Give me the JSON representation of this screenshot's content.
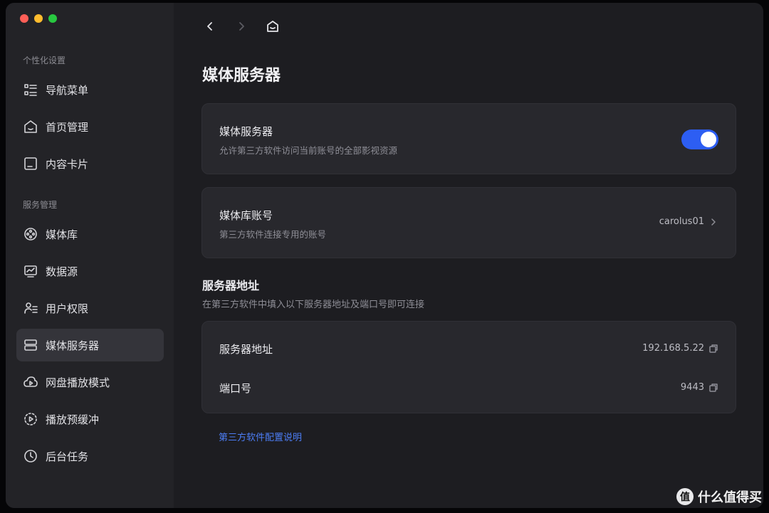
{
  "sidebar": {
    "section_personal": "个性化设置",
    "section_service": "服务管理",
    "items": [
      {
        "label": "导航菜单",
        "icon": "list-icon"
      },
      {
        "label": "首页管理",
        "icon": "home-icon"
      },
      {
        "label": "内容卡片",
        "icon": "card-icon"
      },
      {
        "label": "媒体库",
        "icon": "film-reel-icon"
      },
      {
        "label": "数据源",
        "icon": "monitor-chart-icon"
      },
      {
        "label": "用户权限",
        "icon": "user-list-icon"
      },
      {
        "label": "媒体服务器",
        "icon": "server-icon",
        "active": true
      },
      {
        "label": "网盘播放模式",
        "icon": "cloud-play-icon"
      },
      {
        "label": "播放预缓冲",
        "icon": "buffer-play-icon"
      },
      {
        "label": "后台任务",
        "icon": "clock-icon"
      }
    ]
  },
  "page": {
    "title": "媒体服务器"
  },
  "server_card": {
    "title": "媒体服务器",
    "desc": "允许第三方软件访问当前账号的全部影视资源",
    "enabled": true
  },
  "account_card": {
    "title": "媒体库账号",
    "desc": "第三方软件连接专用的账号",
    "value": "carolus01"
  },
  "address_section": {
    "title": "服务器地址",
    "desc": "在第三方软件中填入以下服务器地址及端口号即可连接",
    "rows": [
      {
        "label": "服务器地址",
        "value": "192.168.5.22"
      },
      {
        "label": "端口号",
        "value": "9443"
      }
    ]
  },
  "help_link": "第三方软件配置说明",
  "watermark": {
    "badge": "值",
    "text": "什么值得买"
  },
  "colors": {
    "accent": "#2d5ef3",
    "link": "#4c7df5"
  }
}
